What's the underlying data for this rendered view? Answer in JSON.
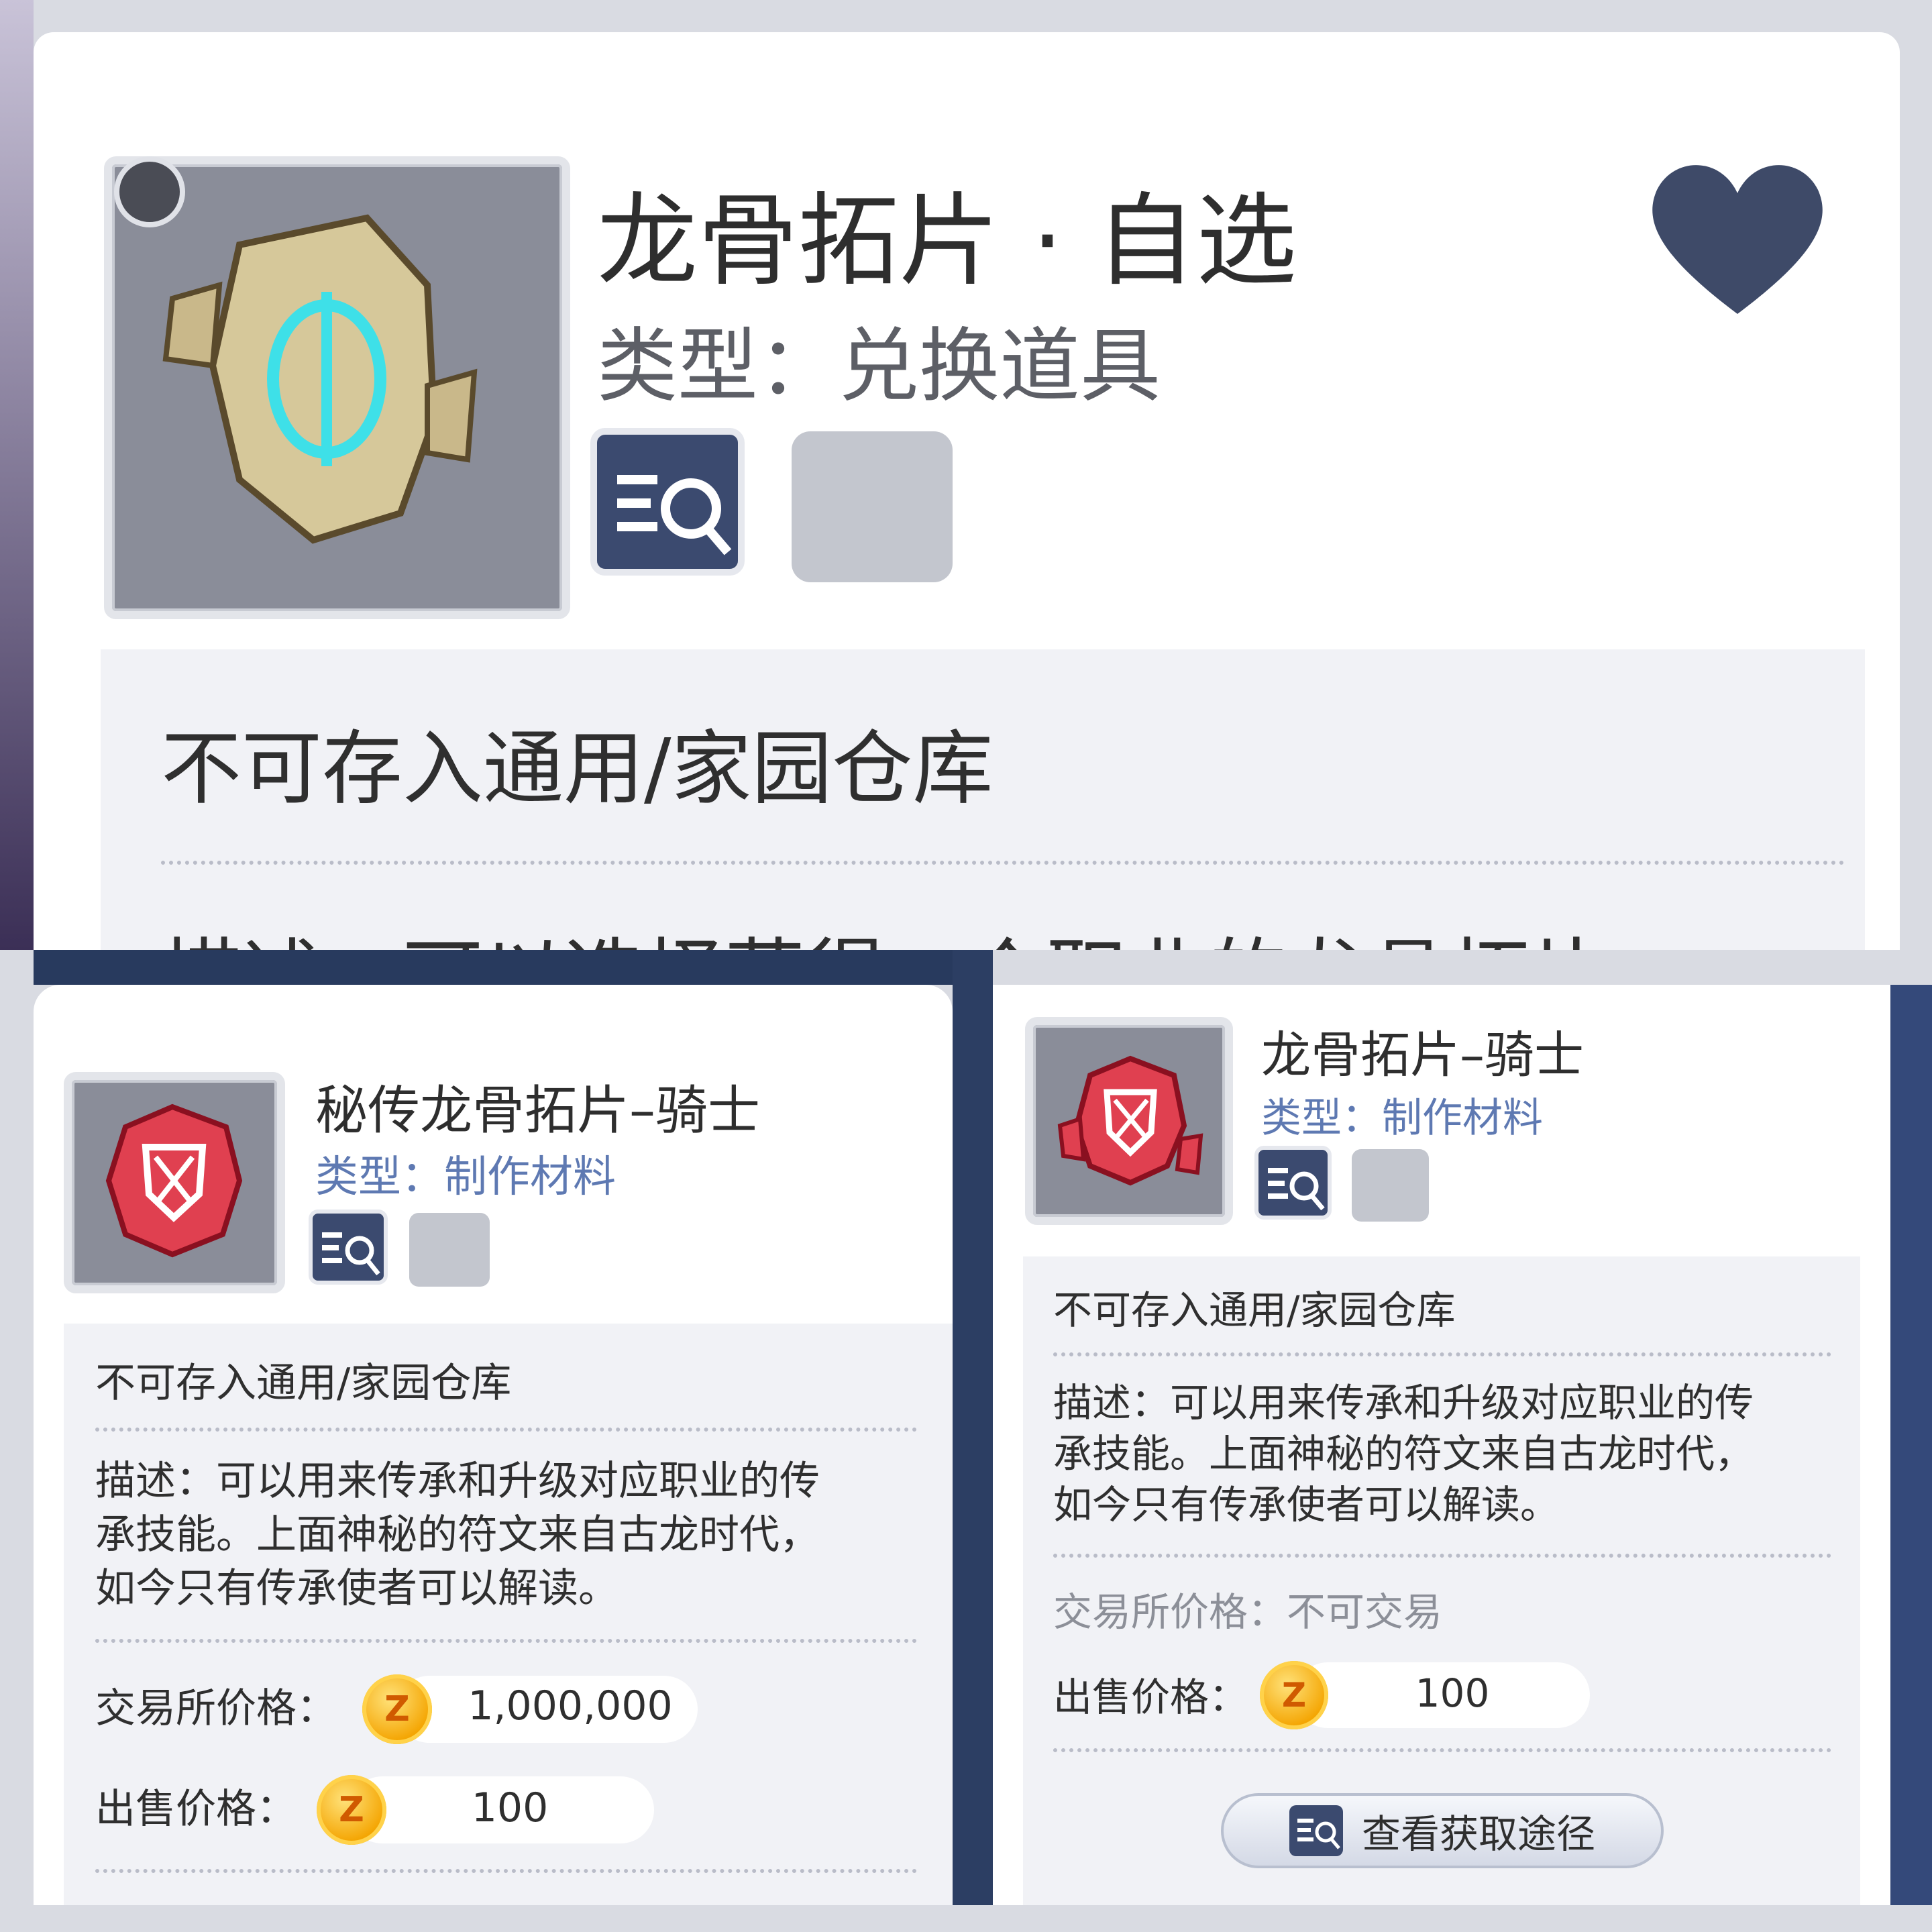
{
  "top_card": {
    "title": "龙骨拓片 · 自选",
    "type_line": "类型：兑换道具",
    "storage_note": "不可存入通用/家园仓库",
    "desc_partial": "描述：可以选择获得一个职业的龙骨拓片"
  },
  "bottom_left_card": {
    "title": "秘传龙骨拓片–骑士",
    "type_line": "类型：制作材料",
    "storage_note": "不可存入通用/家园仓库",
    "desc_lines": [
      "描述：可以用来传承和升级对应职业的传",
      "承技能。上面神秘的符文来自古龙时代，",
      "如今只有传承使者可以解读。"
    ],
    "exchange_label": "交易所价格：",
    "exchange_value": "1,000,000",
    "sell_label": "出售价格：",
    "sell_value": "100"
  },
  "bottom_right_card": {
    "title": "龙骨拓片–骑士",
    "type_line": "类型：制作材料",
    "storage_note": "不可存入通用/家园仓库",
    "desc_lines": [
      "描述：可以用来传承和升级对应职业的传",
      "承技能。上面神秘的符文来自古龙时代，",
      "如今只有传承使者可以解读。"
    ],
    "exchange_line": "交易所价格：不可交易",
    "sell_label": "出售价格：",
    "sell_value": "100",
    "source_button": "查看获取途径"
  },
  "coin_letter": "Z",
  "colors": {
    "heart": "#3e4a68",
    "type_blue": "#5e79b2",
    "panel": "#f1f2f6",
    "icon_bg": "#8a8d99"
  }
}
